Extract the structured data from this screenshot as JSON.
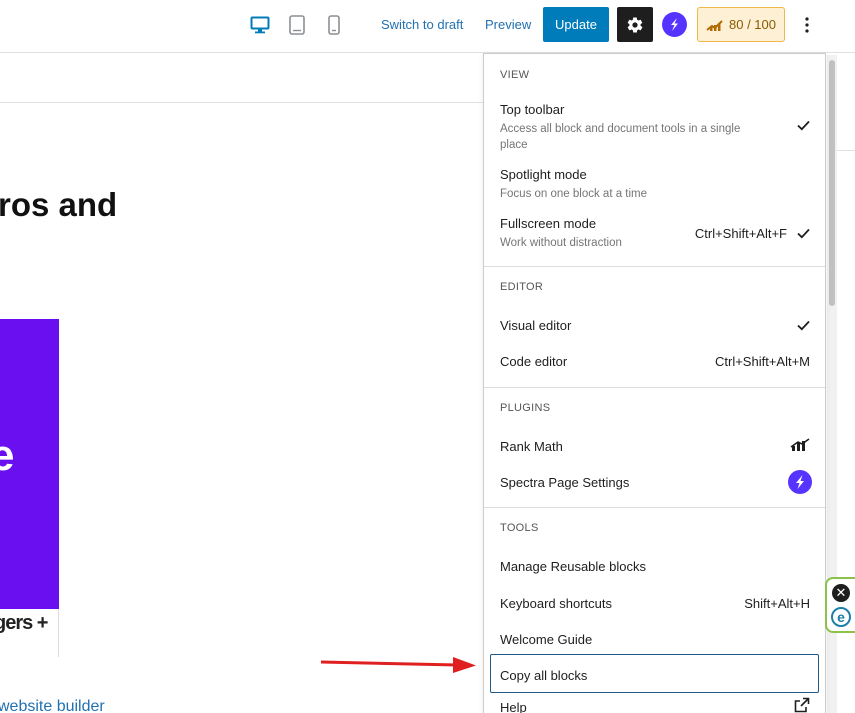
{
  "topbar": {
    "switch_to_draft": "Switch to draft",
    "preview": "Preview",
    "update": "Update",
    "score": "80 / 100",
    "icons": [
      "desktop-icon",
      "tablet-icon",
      "mobile-icon",
      "gear-icon",
      "spectra-icon",
      "rank-math-icon",
      "more-vertical-icon"
    ]
  },
  "canvas": {
    "heading_fragment": "ros and",
    "purple_letter": "e",
    "caption_fragment": "gers +",
    "link_fragment": "website builder"
  },
  "menu": {
    "view": {
      "title": "VIEW",
      "items": [
        {
          "label": "Top toolbar",
          "desc": "Access all block and document tools in a single place",
          "shortcut": "",
          "checked": true
        },
        {
          "label": "Spotlight mode",
          "desc": "Focus on one block at a time",
          "shortcut": "",
          "checked": false
        },
        {
          "label": "Fullscreen mode",
          "desc": "Work without distraction",
          "shortcut": "Ctrl+Shift+Alt+F",
          "checked": true
        }
      ]
    },
    "editor": {
      "title": "EDITOR",
      "items": [
        {
          "label": "Visual editor",
          "shortcut": "",
          "checked": true
        },
        {
          "label": "Code editor",
          "shortcut": "Ctrl+Shift+Alt+M",
          "checked": false
        }
      ]
    },
    "plugins": {
      "title": "PLUGINS",
      "items": [
        {
          "label": "Rank Math",
          "icon": "rank-math-icon"
        },
        {
          "label": "Spectra Page Settings",
          "icon": "spectra-icon"
        }
      ]
    },
    "tools": {
      "title": "TOOLS",
      "items": [
        {
          "label": "Manage Reusable blocks",
          "shortcut": ""
        },
        {
          "label": "Keyboard shortcuts",
          "shortcut": "Shift+Alt+H"
        },
        {
          "label": "Welcome Guide",
          "shortcut": ""
        },
        {
          "label": "Copy all blocks",
          "shortcut": ""
        },
        {
          "label": "Help",
          "icon": "external-link-icon"
        }
      ]
    }
  },
  "colors": {
    "accent": "#007cba",
    "link": "#2271b1",
    "spectra": "#5733ff",
    "purple_block": "#6a0fef",
    "arrow": "#e02020",
    "widget_border": "#8bc34a"
  },
  "widget": {
    "close_symbol": "✕",
    "e_symbol": "e"
  }
}
